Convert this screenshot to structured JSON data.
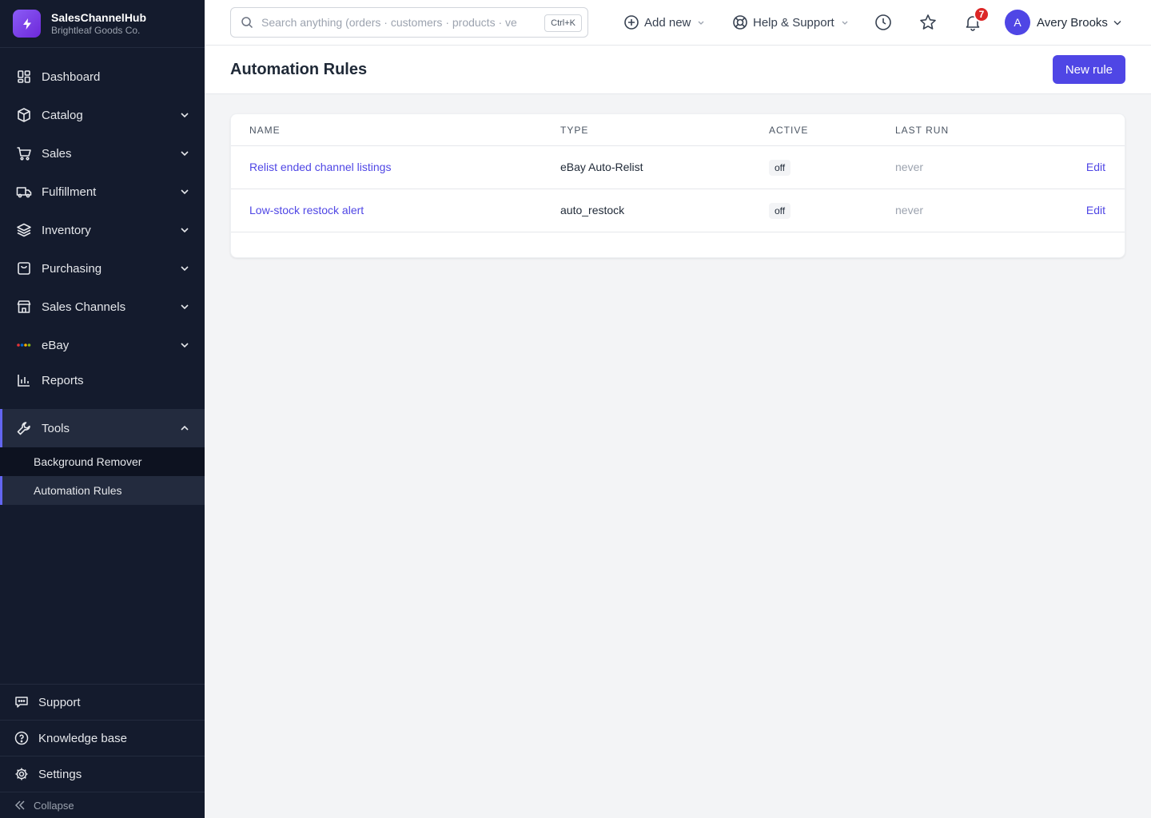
{
  "brand": {
    "name": "SalesChannelHub",
    "org": "Brightleaf Goods Co."
  },
  "sidebar": {
    "items": [
      {
        "label": "Dashboard",
        "icon": "dashboard-icon"
      },
      {
        "label": "Catalog",
        "icon": "box-icon"
      },
      {
        "label": "Sales",
        "icon": "cart-icon"
      },
      {
        "label": "Fulfillment",
        "icon": "truck-icon"
      },
      {
        "label": "Inventory",
        "icon": "layers-icon"
      },
      {
        "label": "Purchasing",
        "icon": "shopping-bag-icon"
      },
      {
        "label": "Sales Channels",
        "icon": "store-icon"
      },
      {
        "label": "eBay",
        "icon": "ebay-logo-icon"
      },
      {
        "label": "Reports",
        "icon": "bar-chart-icon"
      },
      {
        "label": "Tools",
        "icon": "wrench-icon",
        "expanded": true
      }
    ],
    "tools_sub": [
      {
        "label": "Background Remover"
      },
      {
        "label": "Automation Rules",
        "active": true
      }
    ],
    "bottom": {
      "support": "Support",
      "knowledge_base": "Knowledge base",
      "settings": "Settings",
      "collapse": "Collapse"
    }
  },
  "topbar": {
    "search_placeholder": "Search anything (orders · customers · products · ve",
    "search_shortcut": "Ctrl+K",
    "add_new": "Add new",
    "help": "Help & Support",
    "notifications_count": "7",
    "user_initial": "A",
    "user_name": "Avery Brooks"
  },
  "page": {
    "title": "Automation Rules",
    "new_rule_button": "New rule"
  },
  "table": {
    "headers": {
      "name": "NAME",
      "type": "TYPE",
      "active": "ACTIVE",
      "last_run": "LAST RUN"
    },
    "rows": [
      {
        "name": "Relist ended channel listings",
        "type": "eBay Auto-Relist",
        "active": "off",
        "last_run": "never",
        "action": "Edit"
      },
      {
        "name": "Low-stock restock alert",
        "type": "auto_restock",
        "active": "off",
        "last_run": "never",
        "action": "Edit"
      }
    ]
  },
  "colors": {
    "sidebar_bg": "#141b2d",
    "accent": "#4f46e5",
    "badge": "#dc2626"
  }
}
